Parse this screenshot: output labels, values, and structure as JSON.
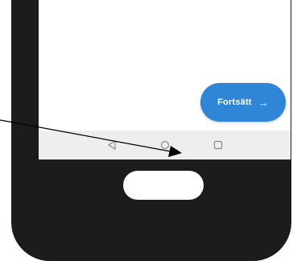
{
  "screen": {
    "continue_button": {
      "label": "Fortsätt",
      "arrow": "→",
      "color": "#2f86d6"
    }
  },
  "navbar": {
    "icons": [
      "back-icon",
      "home-icon",
      "recents-icon"
    ],
    "background": "#eeeeee"
  },
  "device": {
    "frame_color": "#1c1c1c",
    "home_button_color": "#ffffff"
  },
  "annotation": {
    "arrow_color": "#000000"
  }
}
